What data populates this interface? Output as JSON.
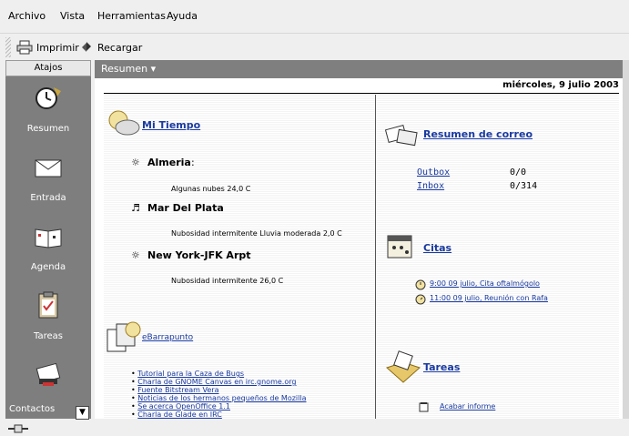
{
  "menu": [
    {
      "label": "Archivo"
    },
    {
      "label": "Vista"
    },
    {
      "label": "Herramientas"
    },
    {
      "label": "Ayuda"
    }
  ],
  "toolbar": {
    "print_label": "Imprimir",
    "reload_label": "Recargar"
  },
  "sidebar": {
    "header": "Atajos",
    "items": [
      {
        "label": "Resumen",
        "icon": "clock-icon"
      },
      {
        "label": "Entrada",
        "icon": "envelope-icon"
      },
      {
        "label": "Agenda",
        "icon": "calendar-book-icon"
      },
      {
        "label": "Tareas",
        "icon": "clipboard-icon"
      },
      {
        "label": "Contactos",
        "icon": "contacts-icon"
      }
    ]
  },
  "content": {
    "header": "Resumen ▾",
    "date": "miércoles, 9 julio 2003",
    "weather": {
      "title": "Mi Tiempo",
      "places": [
        {
          "name": "Almeria",
          "desc": "Algunas nubes 24,0 C"
        },
        {
          "name": "Mar Del Plata",
          "desc": "Nubosidad intermitente Lluvia moderada 2,0 C"
        },
        {
          "name": "New York-JFK Arpt",
          "desc": "Nubosidad intermitente 26,0 C"
        }
      ]
    },
    "news": {
      "title": "eBarrapunto",
      "items": [
        "Tutorial para la Caza de Bugs",
        "Charla de GNOME Canvas en irc.gnome.org",
        "Fuente Bitstream Vera",
        "Noticias de los hermanos pequeños de Mozilla",
        "Se acerca OpenOffice 1.1",
        "Charla de Glade en IRC"
      ]
    },
    "mail": {
      "title": "Resumen de correo",
      "folders": [
        {
          "name": "Outbox",
          "count": "0/0"
        },
        {
          "name": "Inbox",
          "count": "0/314"
        }
      ]
    },
    "appointments": {
      "title": "Citas",
      "items": [
        "9:00 09 julio, Cita oftalmógolo",
        "11:00 09 julio, Reunión con Rafa"
      ]
    },
    "tasks": {
      "title": "Tareas",
      "items": [
        "Acabar informe"
      ]
    }
  }
}
